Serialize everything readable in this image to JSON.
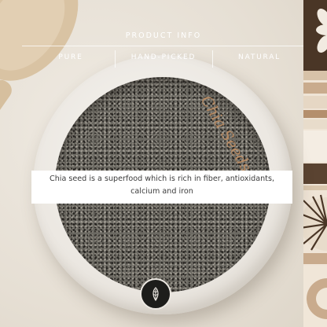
{
  "header": {
    "title": "PRODUCT INFO",
    "tags": [
      "PURE",
      "HAND-PICKED",
      "NATURAL"
    ]
  },
  "product_script": "Chia Seeds",
  "description_line1": "Chia seed is a superfood which is rich in fiber, antioxidants,",
  "description_line2": "calcium and iron",
  "colors": {
    "background": "#e9e3da",
    "seeds": "#6c6a63",
    "bowl": "#ebe7e1",
    "script_text": "#b88b63",
    "caption_bg": "#ffffff",
    "stripe_brown": "#4a3626",
    "stripe_tan": "#c9ab8d"
  },
  "icons": [
    "wooden-spoon",
    "flower-petals-icon",
    "sunburst-icon",
    "leaf-badge-icon"
  ]
}
